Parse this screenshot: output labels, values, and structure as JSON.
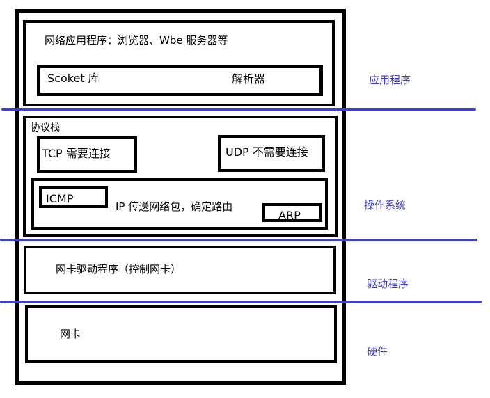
{
  "colors": {
    "box_border": "#000000",
    "divider": "#3f3fbf",
    "layer_label": "#3f3fbf",
    "text": "#000000"
  },
  "app_layer": {
    "title": "网络应用程序：浏览器、Wbe 服务器等",
    "socket_lib": "Scoket 库",
    "resolver": "解析器"
  },
  "os_layer": {
    "title": "协议栈",
    "tcp": "TCP 需要连接",
    "udp": "UDP 不需要连接",
    "icmp": "ICMP",
    "ip": "IP 传送网络包，确定路由",
    "arp": "ARP"
  },
  "driver_layer": {
    "title": "网卡驱动程序（控制网卡）"
  },
  "hardware_layer": {
    "title": "网卡"
  },
  "layer_labels": {
    "application": "应用程序",
    "os": "操作系统",
    "driver": "驱动程序",
    "hardware": "硬件"
  }
}
